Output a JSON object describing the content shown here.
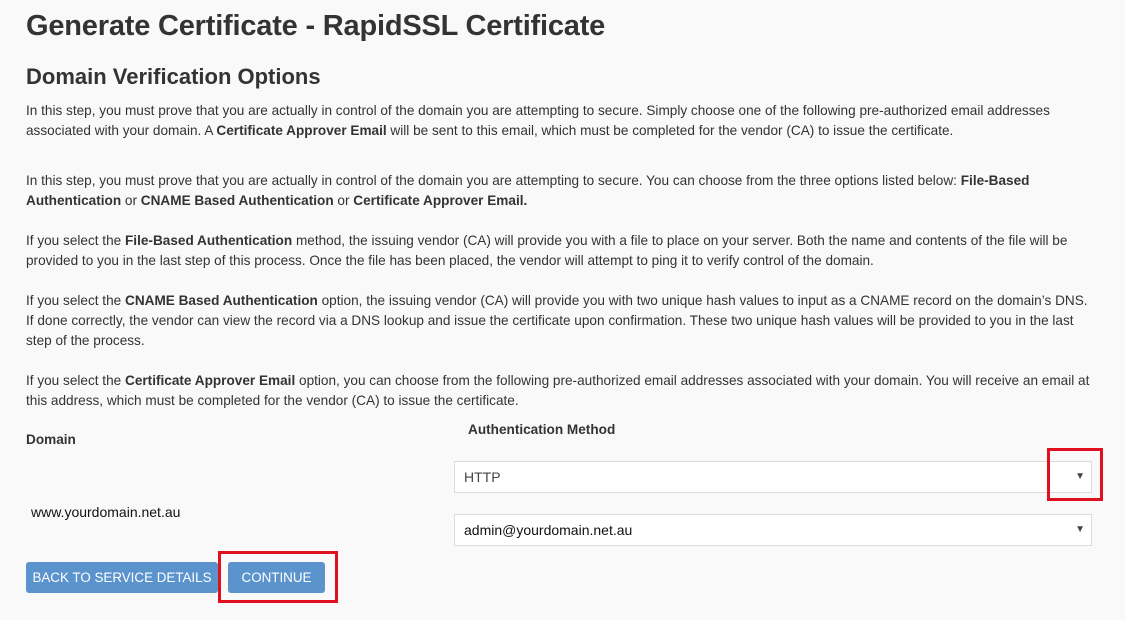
{
  "page": {
    "title": "Generate Certificate - RapidSSL Certificate",
    "section_title": "Domain Verification Options"
  },
  "intro": {
    "p1": [
      "In this step, you must prove that you are actually in control of the domain you are attempting to secure. Simply choose one of the following pre-authorized email addresses associated with your domain. A ",
      "Certificate Approver Email",
      " will be sent to this email, which must be completed for the vendor (CA) to issue the certificate."
    ],
    "p2": [
      "In this step, you must prove that you are actually in control of the domain you are attempting to secure. You can choose from the three options listed below: ",
      "File-Based Authentication",
      " or ",
      "CNAME Based Authentication",
      " or ",
      "Certificate Approver Email."
    ],
    "p3": [
      "If you select the ",
      "File-Based Authentication",
      " method, the issuing vendor (CA) will provide you with a file to place on your server. Both the name and contents of the file will be provided to you in the last step of this process. Once the file has been placed, the vendor will attempt to ping it to verify control of the domain."
    ],
    "p4": [
      "If you select the ",
      "CNAME Based Authentication",
      " option, the issuing vendor (CA) will provide you with two unique hash values to input as a CNAME record on the domain’s DNS. If done correctly, the vendor can view the record via a DNS lookup and issue the certificate upon confirmation. These two unique hash values will be provided to you in the last step of the process."
    ],
    "p5": [
      "If you select the ",
      "Certificate Approver Email",
      " option, you can choose from the following pre-authorized email addresses associated with your domain. You will receive an email at this address, which must be completed for the vendor (CA) to issue the certificate."
    ]
  },
  "form": {
    "domain_label": "Domain",
    "auth_label": "Authentication Method",
    "domain_value": "www.yourdomain.net.au",
    "auth_method_selected": "HTTP",
    "email_selected": "admin@yourdomain.net.au",
    "caret": "▼"
  },
  "buttons": {
    "back_label": "BACK TO SERVICE DETAILS",
    "continue_label": "CONTINUE"
  },
  "colors": {
    "button_bg": "#5b93cc",
    "highlight": "#e0101e",
    "background": "#f9f9f9"
  }
}
